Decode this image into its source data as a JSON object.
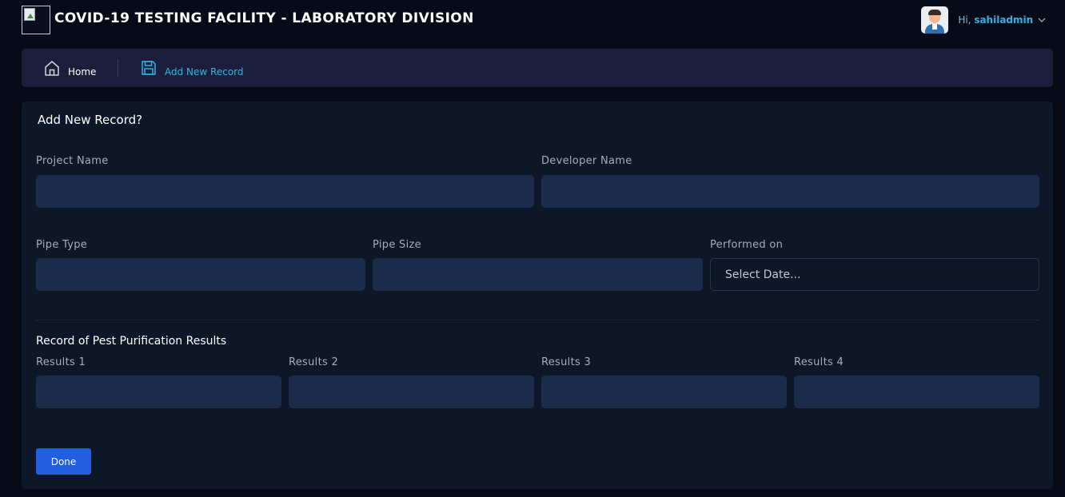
{
  "header": {
    "title": "COVID-19 TESTING FACILITY - LABORATORY DIVISION",
    "greeting": "Hi,",
    "username": "sahiladmin"
  },
  "breadcrumb": {
    "home_label": "Home",
    "current_label": "Add New Record"
  },
  "form": {
    "title": "Add New Record?",
    "project_name_label": "Project Name",
    "project_name_value": "",
    "developer_name_label": "Developer Name",
    "developer_name_value": "",
    "pipe_type_label": "Pipe Type",
    "pipe_type_value": "",
    "pipe_size_label": "Pipe Size",
    "pipe_size_value": "",
    "performed_on_label": "Performed on",
    "performed_on_placeholder": "Select Date...",
    "results_section_title": "Record of Pest Purification Results",
    "results": [
      {
        "label": "Results 1",
        "value": ""
      },
      {
        "label": "Results 2",
        "value": ""
      },
      {
        "label": "Results 3",
        "value": ""
      },
      {
        "label": "Results 4",
        "value": ""
      }
    ],
    "done_label": "Done"
  },
  "colors": {
    "background": "#070b18",
    "breadcrumb_bg": "#1b1f3b",
    "card_bg": "#0d1727",
    "input_bg": "#1b2c4a",
    "accent": "#2bb6e6",
    "button": "#1f5fe0"
  },
  "icons": {
    "logo": "broken-image-icon",
    "home": "home-icon",
    "add_record": "floppy-disk-icon",
    "user_menu": "chevron-down-icon"
  }
}
